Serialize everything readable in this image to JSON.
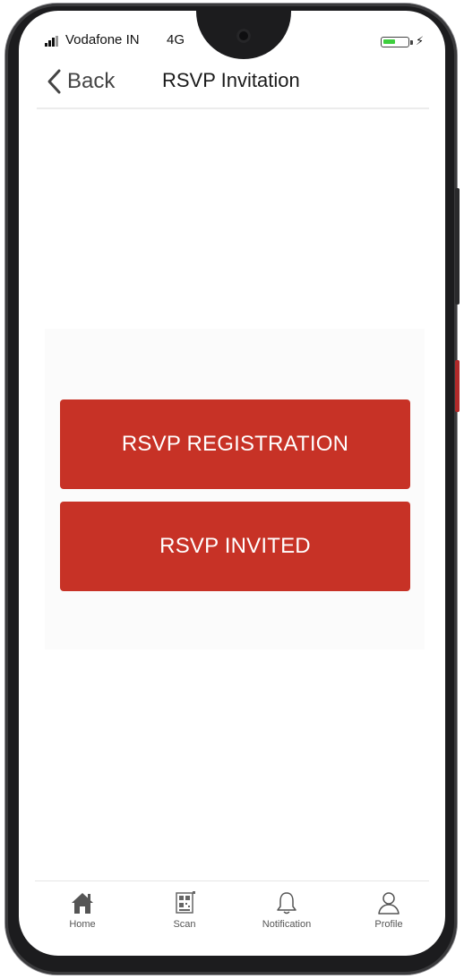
{
  "status_bar": {
    "carrier": "Vodafone IN",
    "network": "4G",
    "battery_level": 0.5,
    "charging_symbol": "⚡"
  },
  "nav": {
    "back_label": "Back",
    "title": "RSVP Invitation"
  },
  "actions": {
    "registration_label": "RSVP REGISTRATION",
    "invited_label": "RSVP INVITED"
  },
  "tabs": [
    {
      "label": "Home",
      "icon": "home-icon"
    },
    {
      "label": "Scan",
      "icon": "qr-code-icon"
    },
    {
      "label": "Notification",
      "icon": "bell-icon"
    },
    {
      "label": "Profile",
      "icon": "user-icon"
    }
  ],
  "colors": {
    "accent": "#c73226",
    "battery": "#3ecf3e"
  }
}
